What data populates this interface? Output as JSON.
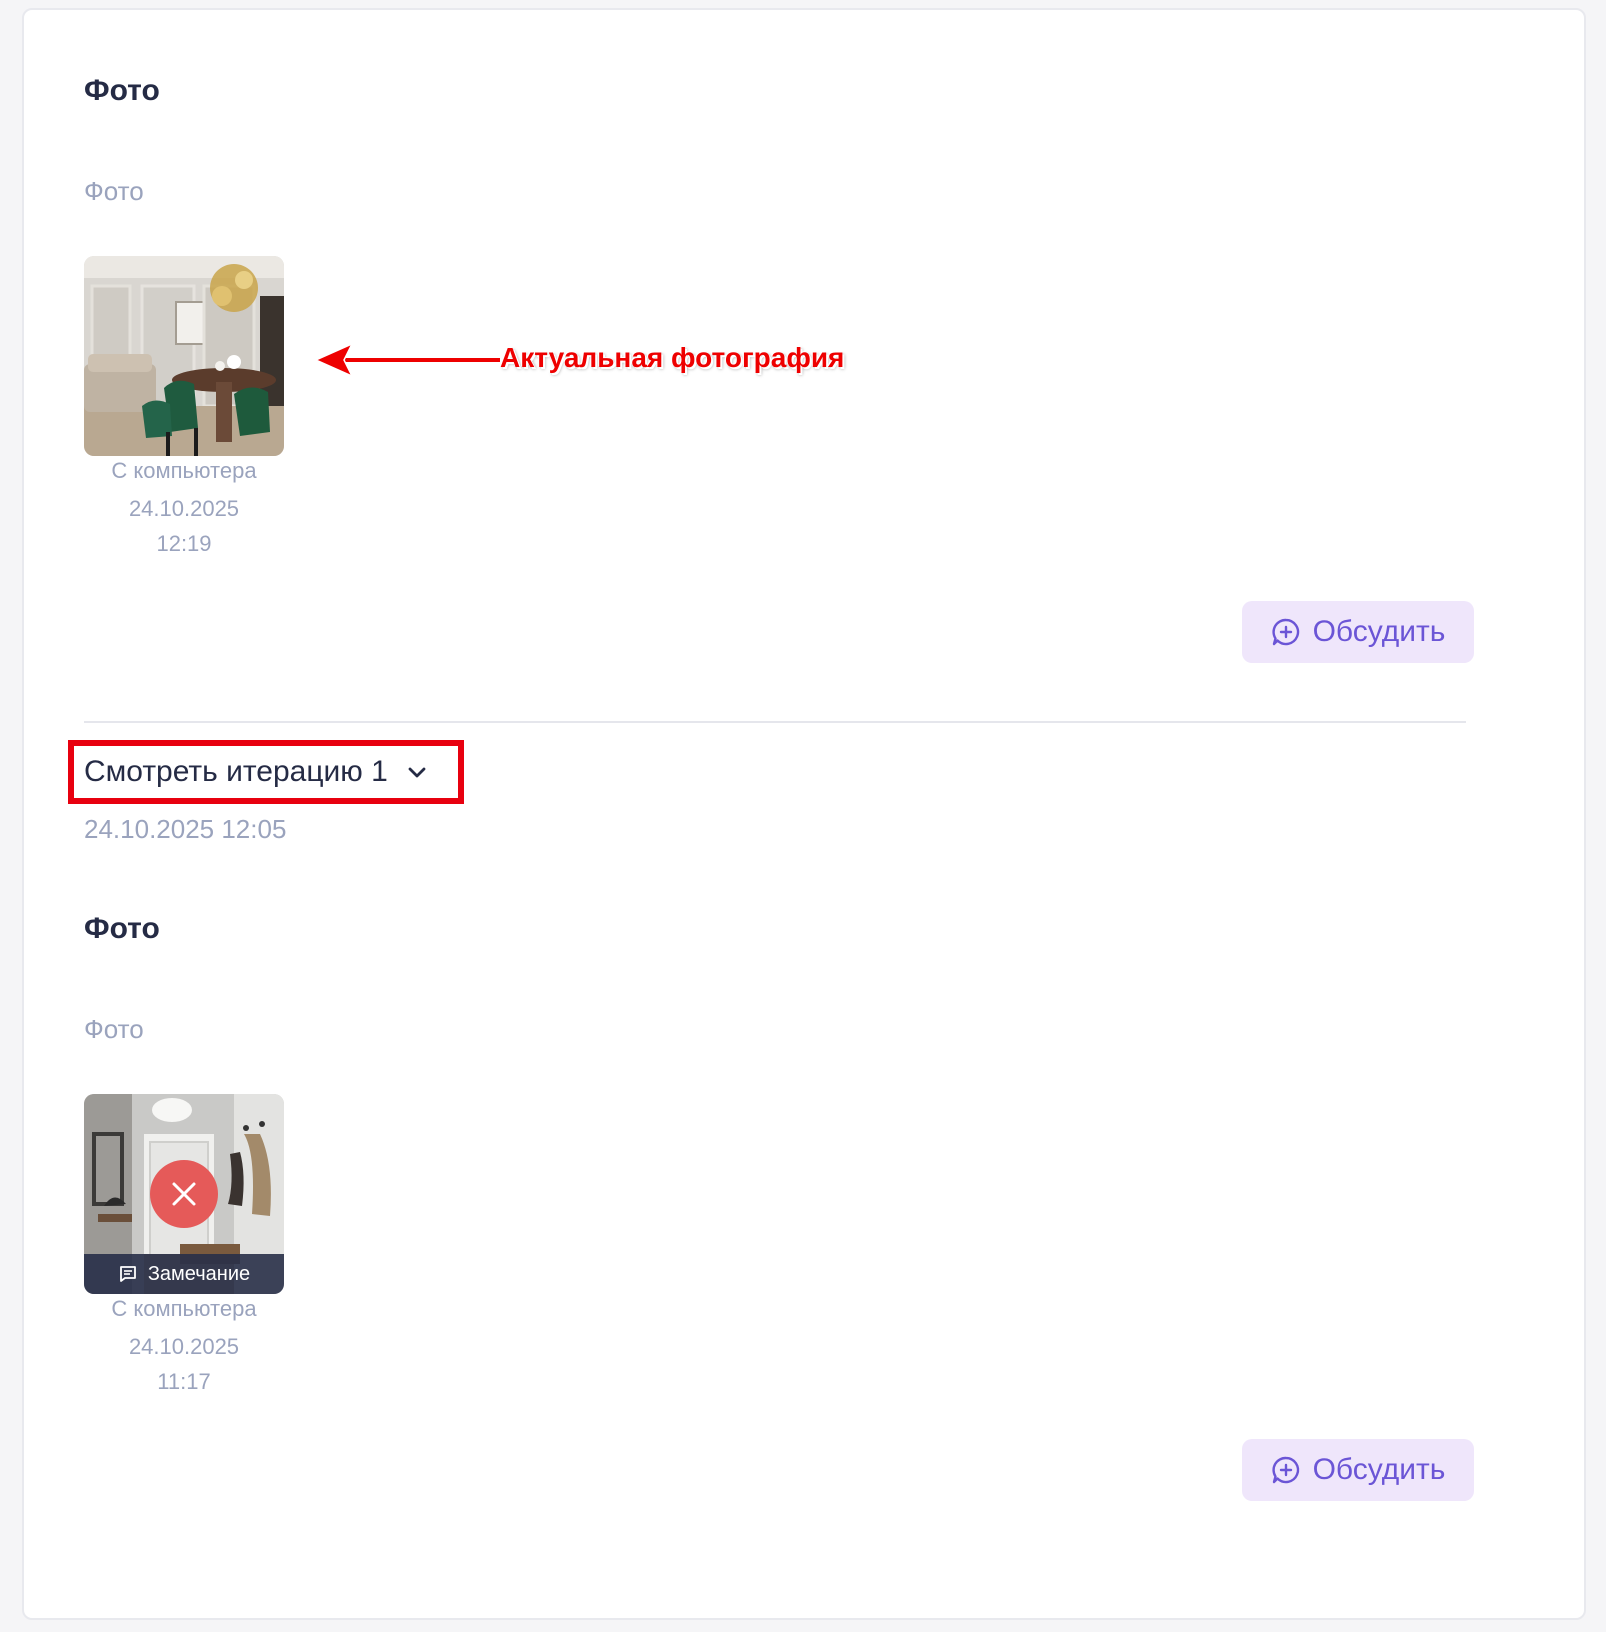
{
  "section1": {
    "title": "Фото",
    "field_label": "Фото",
    "photo": {
      "source": "С компьютера",
      "date": "24.10.2025",
      "time": "12:19"
    },
    "discuss_label": "Обсудить"
  },
  "annotation": {
    "text": "Актуальная фотография",
    "color": "#ee0000"
  },
  "iteration": {
    "toggle_label": "Смотреть итерацию 1",
    "timestamp": "24.10.2025 12:05",
    "section_title": "Фото",
    "field_label": "Фото",
    "photo": {
      "status": "rejected",
      "remark_label": "Замечание",
      "source": "С компьютера",
      "date": "24.10.2025",
      "time": "11:17"
    },
    "discuss_label": "Обсудить"
  },
  "colors": {
    "accent": "#6b55d6",
    "accent_bg": "#efe6fb",
    "reject": "#e55a59",
    "highlight_border": "#e8000f"
  },
  "icons": [
    "chat-plus-icon",
    "chevron-down-icon",
    "close-icon",
    "comment-icon",
    "arrow-left-icon"
  ]
}
